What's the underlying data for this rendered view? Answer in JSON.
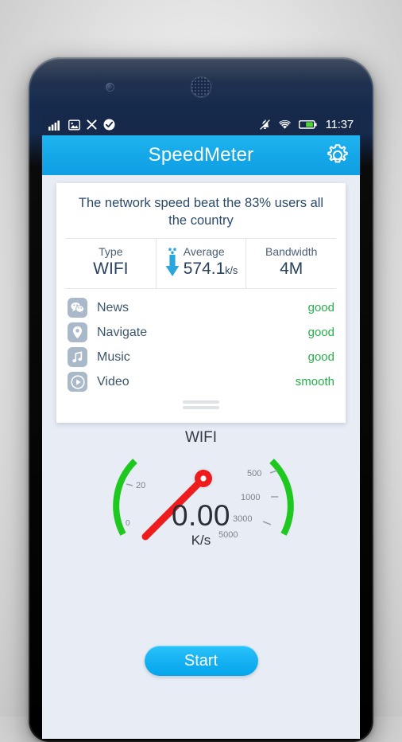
{
  "status_bar": {
    "time": "11:37",
    "left_icons": [
      "signal-bars-icon",
      "image-icon",
      "close-icon",
      "check-circle-icon"
    ],
    "right_icons": [
      "bell-muted-icon",
      "wifi-icon",
      "battery-icon"
    ],
    "background_color": "#16294a"
  },
  "app_bar": {
    "title": "SpeedMeter",
    "settings_icon": "gear-icon",
    "background_color": "#14a7e8"
  },
  "card": {
    "headline": "The network speed beat the 83% users all the country",
    "stats": [
      {
        "label": "Type",
        "value": "WIFI",
        "unit": "",
        "icon": ""
      },
      {
        "label": "Average",
        "value": "574.1",
        "unit": "k/s",
        "icon": "download-arrow-icon"
      },
      {
        "label": "Bandwidth",
        "value": "4M",
        "unit": "",
        "icon": ""
      }
    ],
    "apps": [
      {
        "icon": "wechat-icon",
        "name": "News",
        "status": "good"
      },
      {
        "icon": "location-pin-icon",
        "name": "Navigate",
        "status": "good"
      },
      {
        "icon": "music-note-icon",
        "name": "Music",
        "status": "good"
      },
      {
        "icon": "play-circle-icon",
        "name": "Video",
        "status": "smooth"
      }
    ],
    "status_color": "#26b04a"
  },
  "gauge": {
    "label": "WIFI",
    "value": "0.00",
    "unit": "K/s",
    "left_ticks": [
      "20",
      "0"
    ],
    "right_ticks": [
      "500",
      "1000",
      "3000",
      "5000"
    ],
    "arc_color": "#1ec81e",
    "needle_color": "#ee1c1c"
  },
  "start_button": {
    "label": "Start",
    "color": "#14b2f2"
  }
}
